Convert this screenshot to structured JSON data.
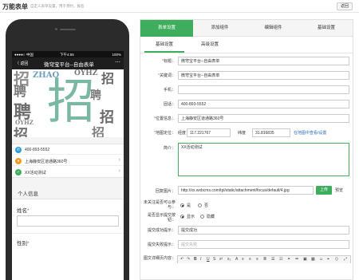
{
  "header": {
    "title": "万能表单",
    "subtitle": "自定义表单设置，用于预约，报名",
    "back_label": "返回"
  },
  "phone": {
    "status_left": "●●●●○ 中国",
    "status_time": "下午4:55",
    "status_right": "100%",
    "nav_back": "〈 返回",
    "nav_title": "微穹宝平台--自由表单",
    "nav_more": "⋯",
    "banner_char": "招",
    "contacts": [
      {
        "icon": "phone-icon",
        "text": "400-893-5552",
        "color": "#2b9ed8"
      },
      {
        "icon": "location-icon",
        "text": "上海静安区道通路360号",
        "color": "#f39a1f"
      },
      {
        "icon": "activity-icon",
        "text": "XX活动测试",
        "color": "#3fae5c"
      }
    ],
    "section_title": "个人信息",
    "fields": [
      {
        "label": "姓名",
        "required": "*"
      },
      {
        "label": "性别",
        "required": "*"
      }
    ]
  },
  "panel": {
    "tabs": [
      "表单设置",
      "添加组件",
      "编辑组件",
      "基础设置"
    ],
    "subtabs": [
      "基础设置",
      "高级设置"
    ],
    "labels": {
      "title": "标题：",
      "keywords": "关键词：",
      "mobile": "手机：",
      "phone": "固话：",
      "address": "位置信息：",
      "map": "地图定位：",
      "intro": "简介：",
      "cover": "回复图片：",
      "unfollowed": "未关注是否可以参与：",
      "show_progress": "是否显示提交按钮：",
      "success_msg": "提交成功提示：",
      "fail_msg": "提交失败提示：",
      "detail": "图文详细页内容："
    },
    "values": {
      "title": "微穹宝平台--自由表单",
      "keywords": "微穹宝平台--自由表单",
      "mobile": "",
      "phone": "400-893-5552",
      "address": "上海静安区道通路360号",
      "lng_label": "经度",
      "lng": "117.221767",
      "lat_label": "纬度",
      "lat": "31.816835",
      "map_link": "在地图中查看/设置",
      "intro": "XX活动测试",
      "cover_url": "http://xx.wxbcms.com/tpl/static/attachment/focus/default/4.jpg",
      "upload": "上传",
      "preview": "预览",
      "radio_yes": "是",
      "radio_no": "否",
      "radio_show": "显示",
      "radio_hide": "隐藏",
      "success_msg": "提交成功",
      "fail_msg_placeholder": "提交失败"
    },
    "required_mark": "*"
  },
  "colors": {
    "accent": "#3fae5c",
    "link": "#2a6ebb",
    "required": "#d9534f"
  }
}
